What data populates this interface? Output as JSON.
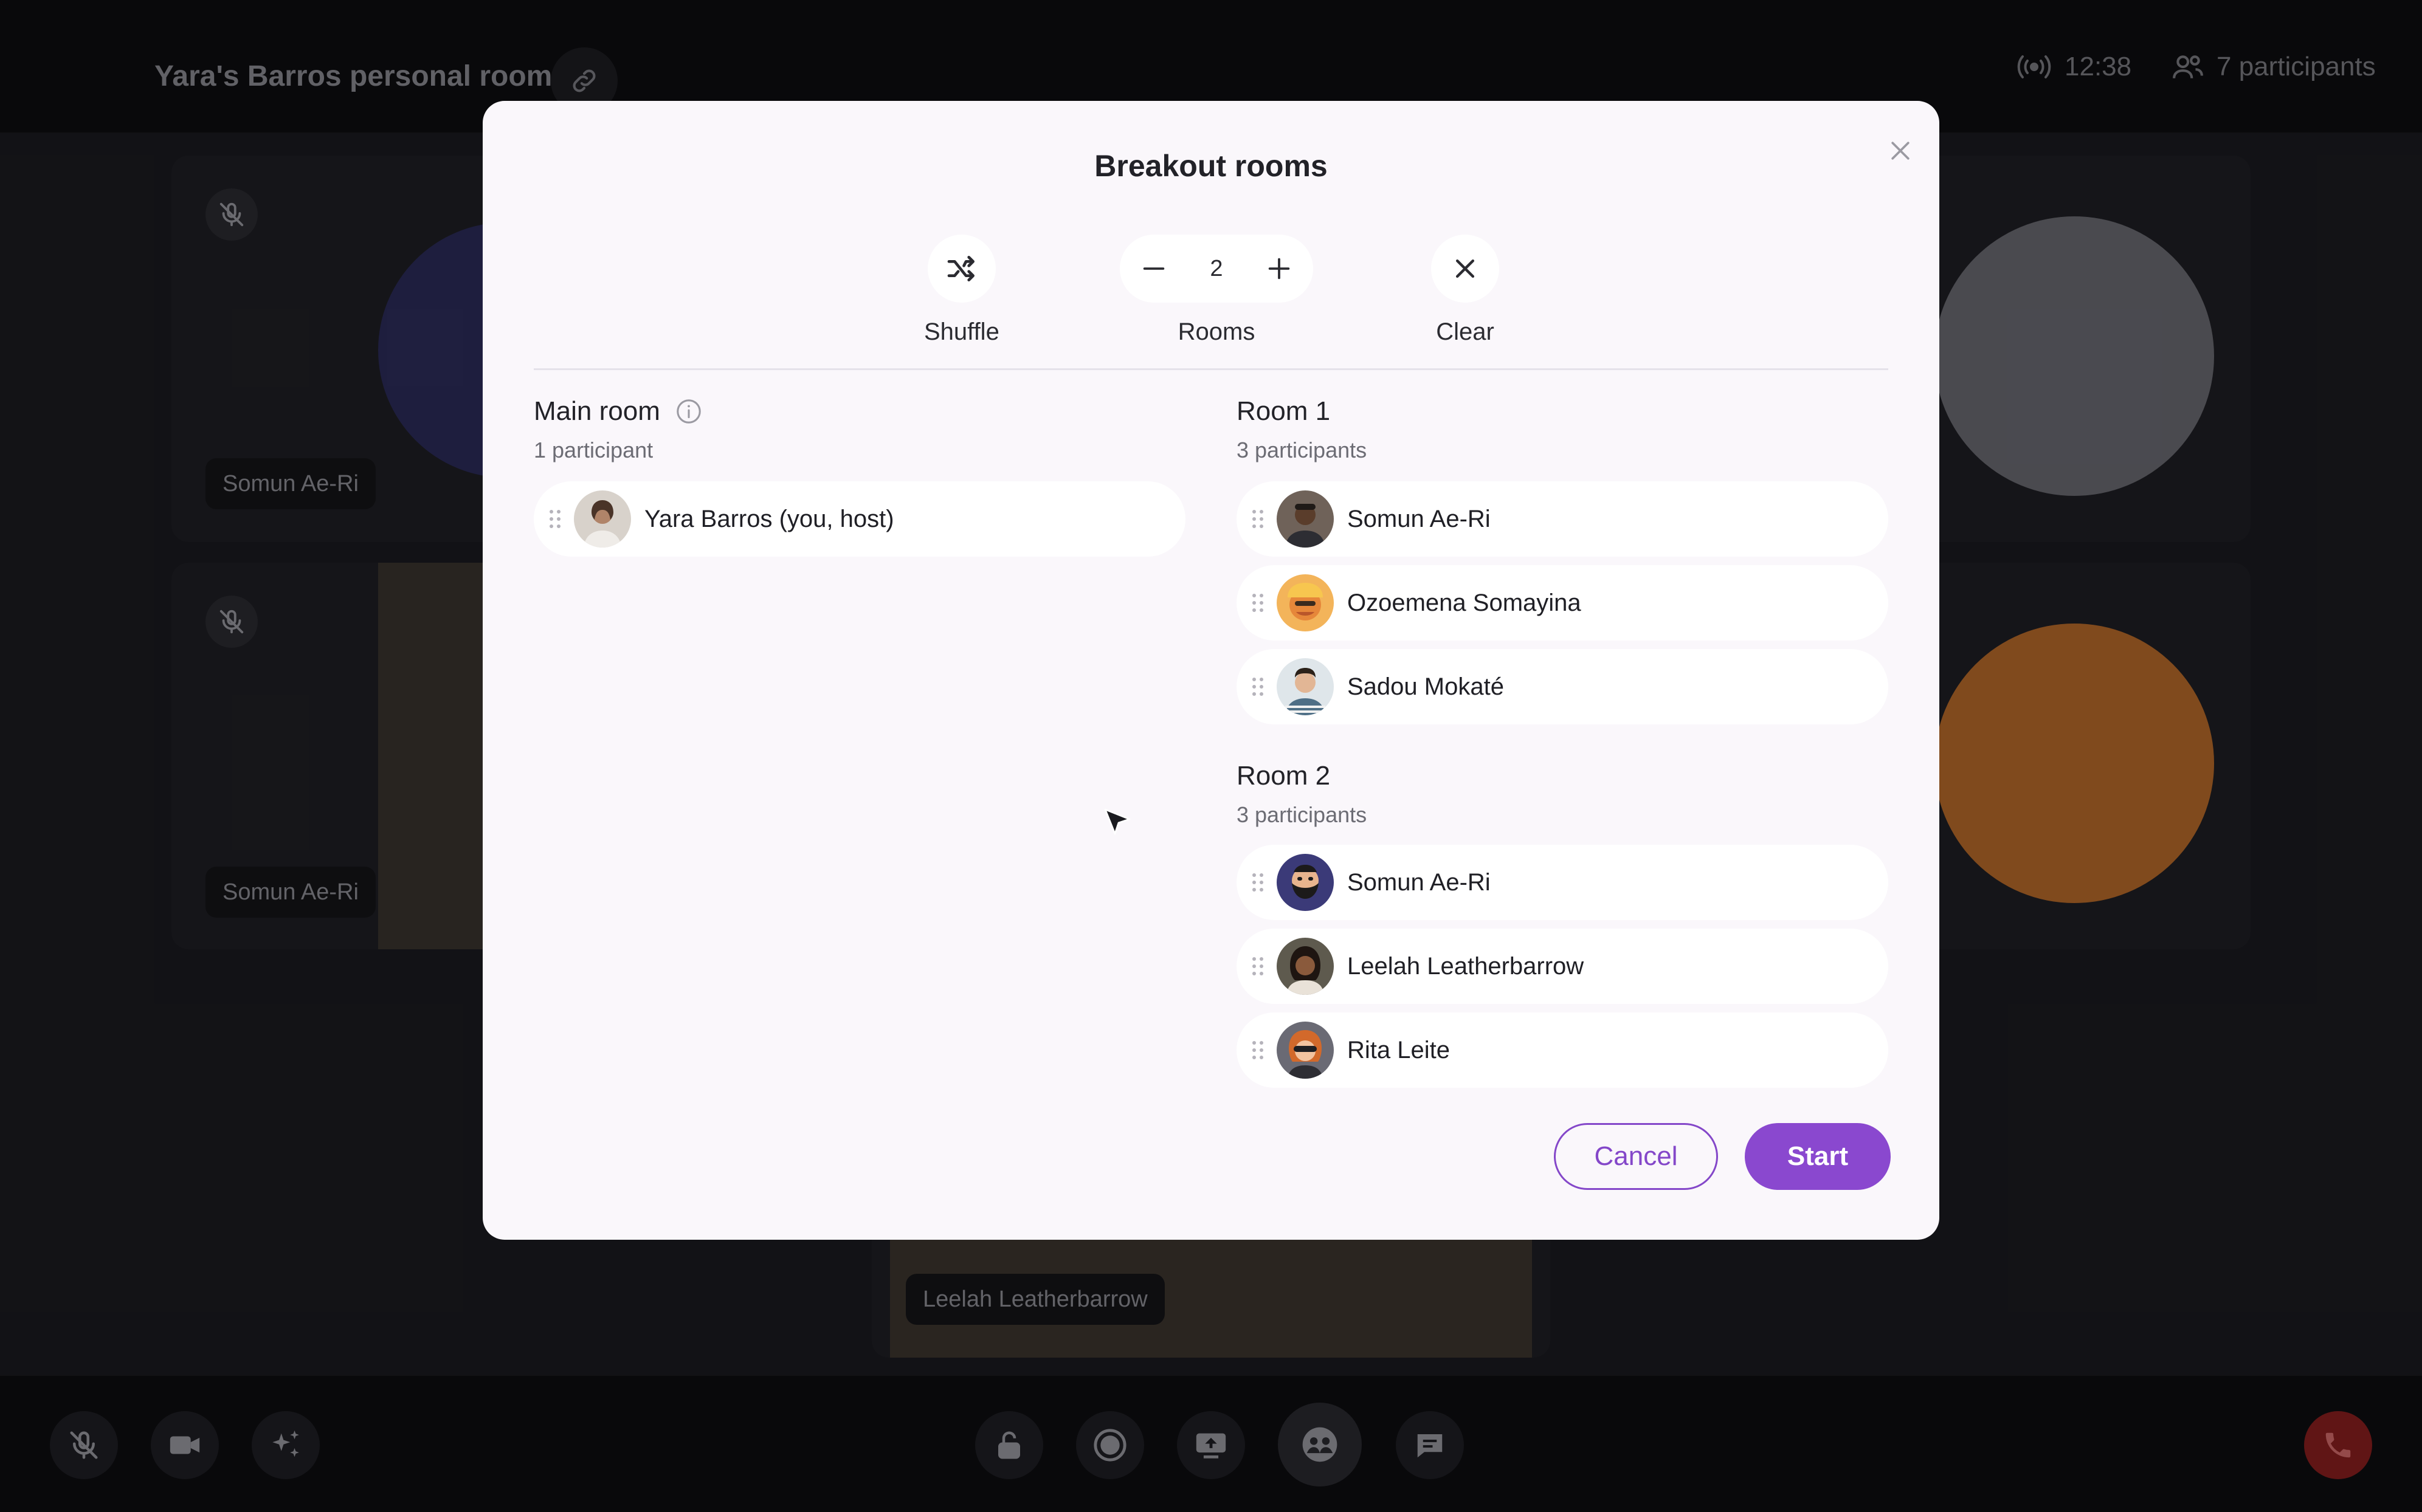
{
  "call": {
    "room_title": "Yara's Barros personal room",
    "time": "12:38",
    "participants_count": "7 participants",
    "tiles": [
      {
        "name": "Somun Ae-Ri"
      },
      {
        "name": "Somun Ae-Ri"
      },
      {
        "name": "Leelah Leatherbarrow"
      }
    ]
  },
  "modal": {
    "title": "Breakout rooms",
    "shuffle_label": "Shuffle",
    "rooms_label": "Rooms",
    "rooms_value": "2",
    "clear_label": "Clear",
    "main_room": {
      "title": "Main room",
      "subtitle": "1 participant",
      "participants": [
        {
          "name": "Yara Barros (you, host)",
          "avatar_color": "#cfc6bd"
        }
      ]
    },
    "rooms": [
      {
        "title": "Room 1",
        "subtitle": "3 participants",
        "participants": [
          {
            "name": "Somun Ae-Ri",
            "avatar_color": "#5a4638"
          },
          {
            "name": "Ozoemena Somayina",
            "avatar_color": "#f0902e"
          },
          {
            "name": "Sadou Mokaté",
            "avatar_color": "#c9d3d8"
          }
        ]
      },
      {
        "title": "Room 2",
        "subtitle": "3 participants",
        "participants": [
          {
            "name": "Somun Ae-Ri",
            "avatar_color": "#3b3a78"
          },
          {
            "name": "Leelah Leatherbarrow",
            "avatar_color": "#6b4a36"
          },
          {
            "name": "Rita Leite",
            "avatar_color": "#e27a3a"
          }
        ]
      }
    ],
    "cancel_label": "Cancel",
    "start_label": "Start"
  },
  "colors": {
    "accent": "#8a48cf",
    "end_call": "#8a1f1f"
  }
}
